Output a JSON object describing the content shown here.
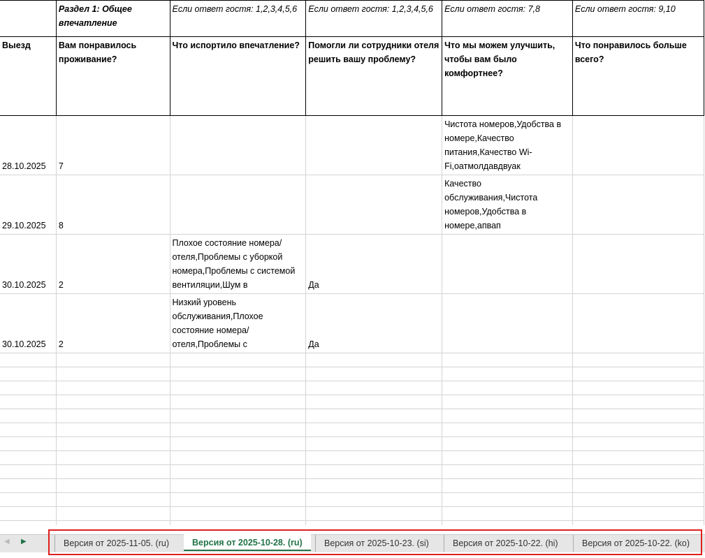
{
  "header_row1": [
    "",
    "Раздел 1: Общее впечатление",
    "Если ответ гостя: 1,2,3,4,5,6",
    "Если ответ гостя: 1,2,3,4,5,6",
    "Если ответ гостя: 7,8",
    "Если ответ гостя: 9,10"
  ],
  "header_row2": [
    "Выезд",
    "Вам понравилось проживание?",
    "Что испортило впечатление?",
    "Помогли ли сотрудники отеля решить вашу проблему?",
    "Что мы можем улучшить, чтобы вам было комфортнее?",
    "Что понравилось больше всего?"
  ],
  "rows": [
    [
      "28.10.2025",
      "7",
      "",
      "",
      "Чистота номеров,Удобства в номере,Качество питания,Качество Wi-Fi,оатмолдавдвуак",
      ""
    ],
    [
      "29.10.2025",
      "8",
      "",
      "",
      "Качество обслуживания,Чистота номеров,Удобства в номере,апвап",
      ""
    ],
    [
      "30.10.2025",
      "2",
      "Плохое состояние номера/отеля,Проблемы с уборкой номера,Проблемы с системой вентиляции,Шум в",
      "Да",
      "",
      ""
    ],
    [
      "30.10.2025",
      "2",
      "Низкий уровень обслуживания,Плохое состояние номера/отеля,Проблемы с",
      "Да",
      "",
      ""
    ]
  ],
  "sheet_tabs": [
    {
      "label": "Версия от 2025-11-05. (ru)",
      "active": false
    },
    {
      "label": "Версия от 2025-10-28. (ru)",
      "active": true
    },
    {
      "label": "Версия от 2025-10-23. (si)",
      "active": false
    },
    {
      "label": "Версия от 2025-10-22. (hi)",
      "active": false
    },
    {
      "label": "Версия от 2025-10-22. (ko)",
      "active": false
    }
  ],
  "nav": {
    "prev": "◀",
    "next": "▶"
  },
  "colors": {
    "accent": "#217346",
    "highlight": "#e01e1e"
  }
}
